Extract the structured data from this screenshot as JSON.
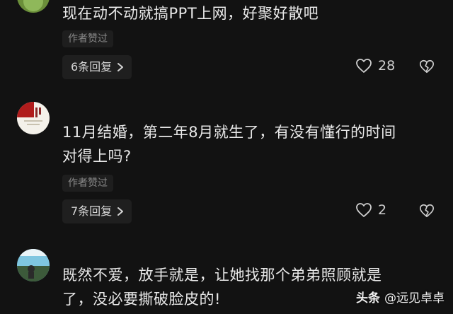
{
  "comments": [
    {
      "text": "现在动不动就搞PPT上网，好聚好散吧",
      "badge": "作者赞过",
      "replies": "6条回复",
      "likes": "28"
    },
    {
      "text": "11月结婚，第二年8月就生了，有没有懂行的时间\n对得上吗?",
      "badge": "作者赞过",
      "replies": "7条回复",
      "likes": "2"
    },
    {
      "text": "既然不爱，放手就是，让她找那个弟弟照顾就是\n了，没必要撕破脸皮的!"
    }
  ],
  "watermark": {
    "brand": "头条",
    "account": "@远见卓卓"
  },
  "colors": {
    "background": "#121212",
    "button_bg": "#1f1f1f",
    "text": "#e8e8e8",
    "muted": "#8a8a8a"
  },
  "icons": {
    "like": "heart-outline-icon",
    "dislike": "broken-heart-icon",
    "chevron": "chevron-right-icon"
  }
}
